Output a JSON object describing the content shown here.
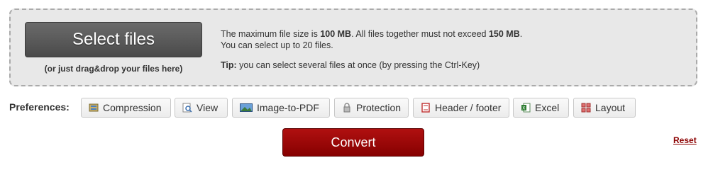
{
  "upload": {
    "select_label": "Select files",
    "drag_hint": "(or just drag&drop your files here)",
    "info_line1_prefix": "The maximum file size is ",
    "max_file_size": "100 MB",
    "info_line1_middle": ". All files together must not exceed ",
    "max_total_size": "150 MB",
    "info_line1_suffix": ".",
    "info_line2": "You can select up to 20 files.",
    "tip_label": "Tip:",
    "tip_text": " you can select several files at once (by pressing the Ctrl-Key)"
  },
  "preferences": {
    "label": "Preferences:",
    "buttons": [
      {
        "label": "Compression",
        "icon": "compression-icon"
      },
      {
        "label": "View",
        "icon": "magnifier-icon"
      },
      {
        "label": "Image-to-PDF",
        "icon": "image-icon"
      },
      {
        "label": "Protection",
        "icon": "lock-icon"
      },
      {
        "label": "Header / footer",
        "icon": "document-icon"
      },
      {
        "label": "Excel",
        "icon": "excel-icon"
      },
      {
        "label": "Layout",
        "icon": "layout-grid-icon"
      }
    ]
  },
  "actions": {
    "convert_label": "Convert",
    "reset_label": "Reset"
  },
  "colors": {
    "convert": "#9b0000",
    "reset_link": "#8b0000",
    "select_button": "#555555"
  }
}
